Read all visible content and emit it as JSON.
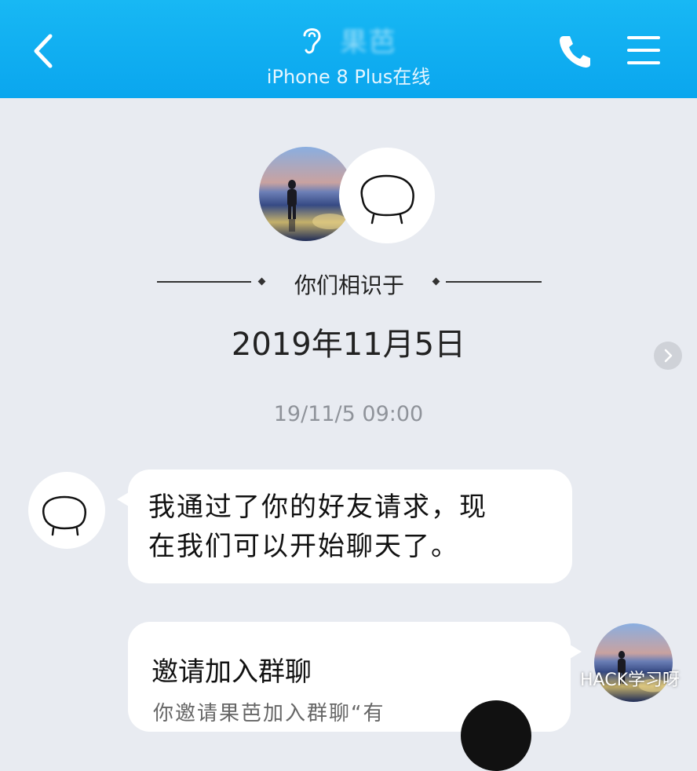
{
  "header": {
    "back_label": "<",
    "contact_name": "果芭",
    "status": "iPhone 8 Plus在线"
  },
  "meet": {
    "label": "你们相识于",
    "date": "2019年11月5日"
  },
  "timestamp": "19/11/5 09:00",
  "messages": [
    {
      "sender": "contact",
      "text_line1": "我通过了你的好友请求，现",
      "text_line2": "在我们可以开始聊天了。"
    }
  ],
  "card": {
    "title": "邀请加入群聊",
    "desc": "你邀请果芭加入群聊“有"
  },
  "watermark": "HACK学习呀",
  "colors": {
    "header_bg": "#12b0f2",
    "chat_bg": "#e8ebf1",
    "bubble_bg": "#ffffff"
  }
}
